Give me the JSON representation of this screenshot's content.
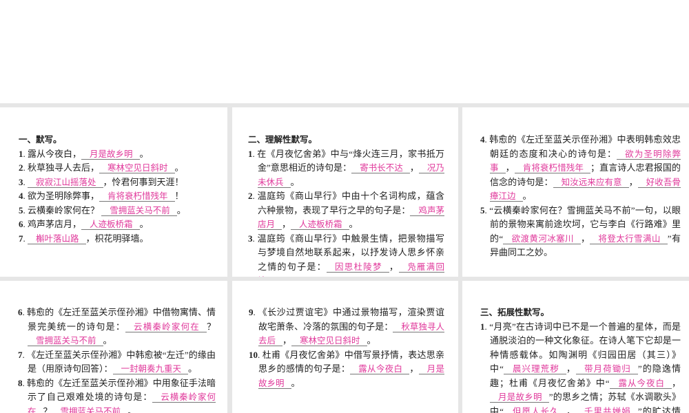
{
  "panels": [
    {
      "heading": "一、默写。",
      "items": [
        [
          {
            "t": "1",
            "n": 1
          },
          {
            "t": ". 露从今夜白，"
          },
          {
            "a": "月是故乡明"
          },
          {
            "t": "。"
          }
        ],
        [
          {
            "t": "2",
            "n": 1
          },
          {
            "t": ". 秋草独寻人去后，"
          },
          {
            "a": "寒林空见日斜时"
          },
          {
            "t": "。"
          }
        ],
        [
          {
            "t": "3",
            "n": 1
          },
          {
            "t": ". "
          },
          {
            "a": "寂寂江山摇落处"
          },
          {
            "t": "，怜君何事到天涯！"
          }
        ],
        [
          {
            "t": "4",
            "n": 1
          },
          {
            "t": ". 欲为圣明除弊事，"
          },
          {
            "a": "肯将衰朽惜残年"
          },
          {
            "t": "！"
          }
        ],
        [
          {
            "t": "5",
            "n": 1
          },
          {
            "t": ". 云横秦岭家何在？ "
          },
          {
            "a": "雪拥蓝关马不前"
          },
          {
            "t": "。"
          }
        ],
        [
          {
            "t": "6",
            "n": 1
          },
          {
            "t": ". 鸡声茅店月，"
          },
          {
            "a": "人迹板桥霜"
          },
          {
            "t": "。"
          }
        ],
        [
          {
            "t": "7",
            "n": 1
          },
          {
            "t": ". "
          },
          {
            "a": "槲叶落山路"
          },
          {
            "t": "，枳花明驿墙。"
          }
        ]
      ]
    },
    {
      "heading": "二、理解性默写。",
      "items": [
        [
          {
            "t": "1",
            "n": 1
          },
          {
            "t": ". 在《月夜忆舍弟》中与“烽火连三月，家书抵万金”意思相近的诗句是："
          },
          {
            "a": "寄书长不达"
          },
          {
            "t": "，"
          },
          {
            "a": "况乃未休兵"
          },
          {
            "t": "。"
          }
        ],
        [
          {
            "t": "2",
            "n": 1
          },
          {
            "t": ". 温庭筠《商山早行》中由十个名词构成，蕴含六种景物，表现了早行之早的句子是："
          },
          {
            "a": "鸡声茅店月"
          },
          {
            "t": "，"
          },
          {
            "a": "人迹板桥霜"
          },
          {
            "t": "。"
          }
        ],
        [
          {
            "t": "3",
            "n": 1
          },
          {
            "t": ". 温庭筠《商山早行》中触景生情，把景物描写与梦境自然地联系起来，以抒发诗人思乡怀亲之情的句子是："
          },
          {
            "a": "因思杜陵梦"
          },
          {
            "t": "，"
          },
          {
            "a": "凫雁满回塘"
          },
          {
            "t": "。"
          }
        ]
      ]
    },
    {
      "heading": "",
      "items": [
        [
          {
            "t": "4",
            "n": 1
          },
          {
            "t": ". 韩愈的《左迁至蓝关示侄孙湘》中表明韩愈效忠朝廷的态度和决心的诗句是："
          },
          {
            "a": "欲为圣明除弊事"
          },
          {
            "t": "，"
          },
          {
            "a": "肯将衰朽惜残年"
          },
          {
            "t": "；直言诗人忠君报国的信念的诗句是："
          },
          {
            "a": "知汝远来应有意"
          },
          {
            "t": "，"
          },
          {
            "a": "好收吾骨瘴江边"
          },
          {
            "t": "。"
          }
        ],
        [
          {
            "t": "5",
            "n": 1
          },
          {
            "t": ". “云横秦岭家何在？雪拥蓝关马不前”一句，以眼前的景物来寓前途坎坷，它与李白《行路难》里的“"
          },
          {
            "a": "欲渡黄河冰塞川"
          },
          {
            "t": "，"
          },
          {
            "a": "将登太行雪满山"
          },
          {
            "t": "”有异曲同工之妙。"
          }
        ]
      ]
    },
    {
      "heading": "",
      "items": [
        [
          {
            "t": "6",
            "n": 1
          },
          {
            "t": ". 韩愈的《左迁至蓝关示侄孙湘》中借物寓情、情景完美统一的诗句是："
          },
          {
            "a": "云横秦岭家何在"
          },
          {
            "t": "？"
          },
          {
            "a": "雪拥蓝关马不前"
          },
          {
            "t": "。"
          }
        ],
        [
          {
            "t": "7",
            "n": 1
          },
          {
            "t": ". 《左迁至蓝关示侄孙湘》中韩愈被“左迁”的缘由是（用原诗句回答）："
          },
          {
            "a": "一封朝奏九重天"
          },
          {
            "t": "。"
          }
        ],
        [
          {
            "t": "8",
            "n": 1
          },
          {
            "t": ". 韩愈的《左迁至蓝关示侄孙湘》中用象征手法暗示了自己艰难处境的诗句是："
          },
          {
            "a": "云横秦岭家何在"
          },
          {
            "t": "？"
          },
          {
            "a": "雪拥蓝关马不前"
          },
          {
            "t": "。"
          }
        ]
      ]
    },
    {
      "heading": "",
      "items": [
        [
          {
            "t": "9",
            "n": 1
          },
          {
            "t": ". 《长沙过贾谊宅》中通过景物描写，渲染贾谊故宅萧条、冷落的氛围的句子是："
          },
          {
            "a": "秋草独寻人去后"
          },
          {
            "t": "，"
          },
          {
            "a": "寒林空见日斜时"
          },
          {
            "t": "。"
          }
        ],
        [
          {
            "t": "10",
            "n": 1
          },
          {
            "t": ". 杜甫《月夜忆舍弟》中借写景抒情，表达思亲思乡的感情的句子是："
          },
          {
            "a": "露从今夜白"
          },
          {
            "t": "，"
          },
          {
            "a": "月是故乡明"
          },
          {
            "t": "。"
          }
        ]
      ]
    },
    {
      "heading": "三、拓展性默写。",
      "items": [
        [
          {
            "t": "1",
            "n": 1
          },
          {
            "t": ". “月亮”在古诗词中已不是一个普遍的星体，而是通脱淡泊的一种文化象征。在诗人笔下它却是一种情感载体。如陶渊明《归园田居（其三）》中“"
          },
          {
            "a": "晨兴理荒秽"
          },
          {
            "t": "，"
          },
          {
            "a": "带月荷锄归"
          },
          {
            "t": "”的隐逸情趣；杜甫《月夜忆舍弟》中“"
          },
          {
            "a": "露从今夜白"
          },
          {
            "t": "，"
          },
          {
            "a": "月是故乡明"
          },
          {
            "t": "”的思乡之情；苏轼《水调歌头》中“"
          },
          {
            "a": "但愿人长久"
          },
          {
            "t": "，"
          },
          {
            "a": "千里共婵娟"
          },
          {
            "t": "”的旷达情怀，无不凝聚着诗人的情感经历"
          }
        ]
      ]
    }
  ]
}
